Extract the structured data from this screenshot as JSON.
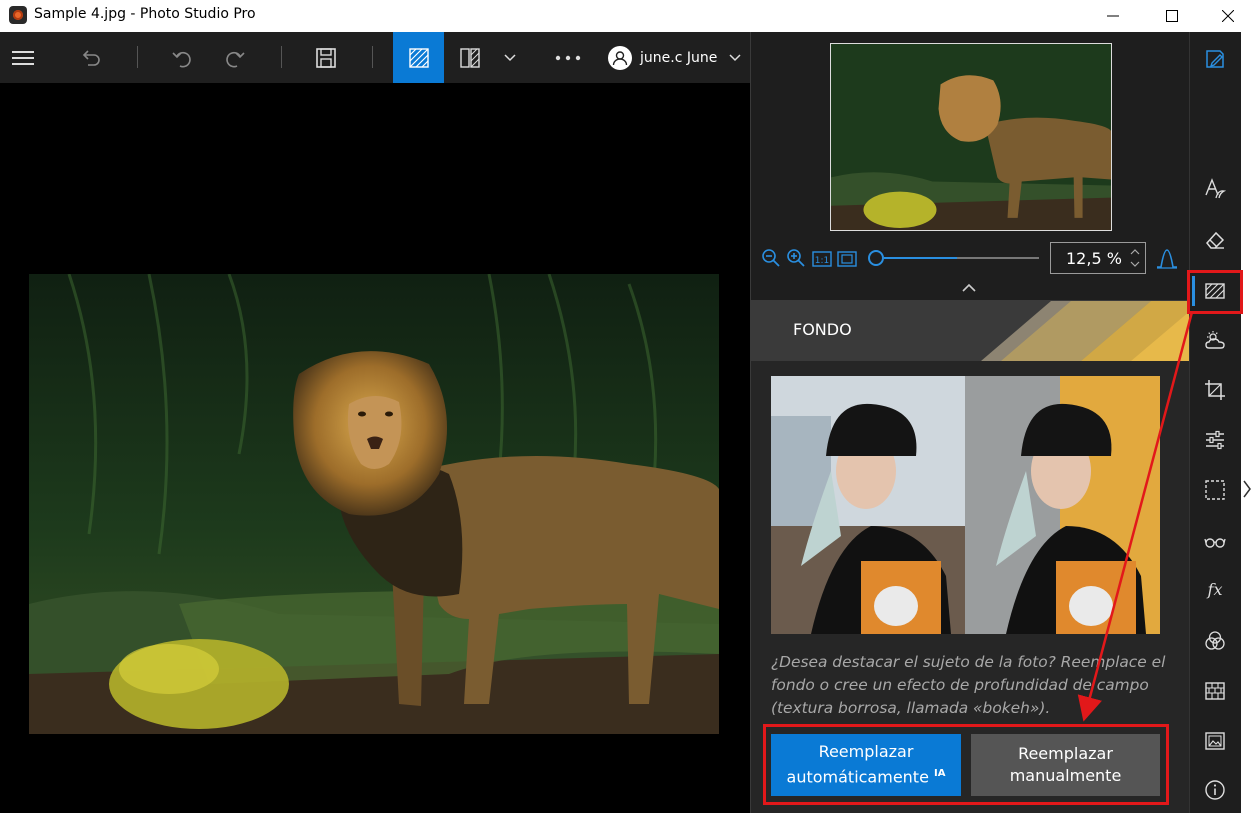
{
  "window": {
    "title": "Sample 4.jpg - Photo Studio Pro",
    "minimize_icon": "minimize-icon",
    "maximize_icon": "maximize-icon",
    "close_icon": "close-icon"
  },
  "toolbar": {
    "icons": [
      "hamburger-menu-icon",
      "undo-icon",
      "undo-step-icon",
      "redo-icon",
      "save-icon",
      "single-view-icon",
      "compare-view-icon",
      "chevron-down-icon",
      "more-options-icon"
    ],
    "user_name": "june.c June",
    "accent": "#0a7ad5"
  },
  "navigator": {
    "zoom_value": "12,5 %",
    "zoom_fraction": 0.1
  },
  "panel": {
    "section_title": "FONDO",
    "description": "¿Desea destacar el sujeto de la foto? Reemplace el fondo o cree un efecto de profundidad de campo (textura borrosa, llamada «bokeh»).",
    "button_auto_label": "Reemplazar automáticamente",
    "button_auto_badge": "IA",
    "button_manual_line1": "Reemplazar",
    "button_manual_line2": "manualmente",
    "highlight_color": "#e2181a"
  },
  "sidebar": {
    "tools": [
      "notes-icon",
      "text-style-icon",
      "eraser-icon",
      "background-icon",
      "weather-icon",
      "crop-icon",
      "adjust-sliders-icon",
      "selection-icon",
      "glasses-icon",
      "fx-icon",
      "color-mix-icon",
      "texture-icon",
      "image-icon",
      "info-icon"
    ],
    "active_tool": "background-icon"
  }
}
